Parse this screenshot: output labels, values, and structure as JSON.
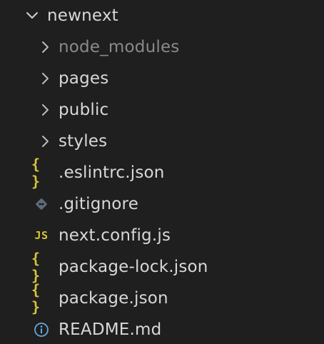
{
  "explorer": {
    "root": {
      "label": "newnext",
      "icon": "chevron-down-icon"
    },
    "folders": [
      {
        "label": "node_modules",
        "icon": "chevron-right-icon",
        "dimmed": true
      },
      {
        "label": "pages",
        "icon": "chevron-right-icon"
      },
      {
        "label": "public",
        "icon": "chevron-right-icon"
      },
      {
        "label": "styles",
        "icon": "chevron-right-icon"
      }
    ],
    "files": [
      {
        "label": ".eslintrc.json",
        "icon": "json-braces-icon",
        "icon_text": "{ }"
      },
      {
        "label": ".gitignore",
        "icon": "git-diamond-icon"
      },
      {
        "label": "next.config.js",
        "icon": "javascript-icon",
        "icon_text": "JS"
      },
      {
        "label": "package-lock.json",
        "icon": "json-braces-icon",
        "icon_text": "{ }"
      },
      {
        "label": "package.json",
        "icon": "json-braces-icon",
        "icon_text": "{ }"
      },
      {
        "label": "README.md",
        "icon": "info-circle-icon"
      }
    ]
  },
  "colors": {
    "background": "#1f1f1f",
    "text": "#d8d8d8",
    "dim_text": "#8a8a8a",
    "json_icon": "#d8c43a",
    "js_icon": "#d8c43a",
    "git_icon": "#5f6b78",
    "info_icon": "#6aa6df"
  }
}
